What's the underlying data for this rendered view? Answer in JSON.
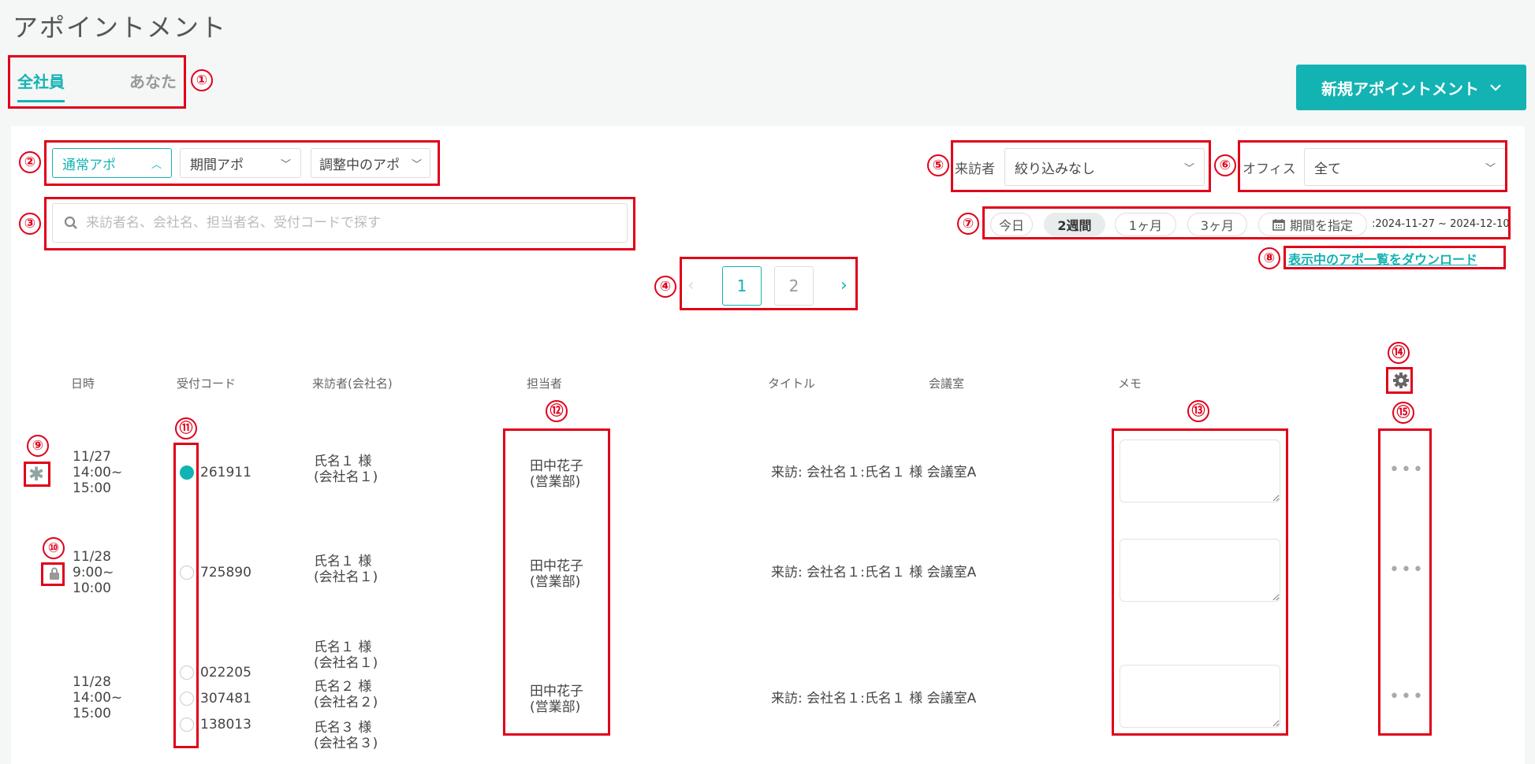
{
  "page": {
    "title": "アポイントメント"
  },
  "tabs": {
    "all": "全社員",
    "you": "あなた"
  },
  "new_button": {
    "label": "新規アポイントメント"
  },
  "filters": {
    "type_dropdowns": [
      "通常アポ",
      "期間アポ",
      "調整中のアポ"
    ],
    "visitor_label": "来訪者",
    "visitor_value": "絞り込みなし",
    "office_label": "オフィス",
    "office_value": "全て"
  },
  "search": {
    "placeholder": "来訪者名、会社名、担当者名、受付コードで探す"
  },
  "period": {
    "buttons": [
      "今日",
      "2週間",
      "1ヶ月",
      "3ヶ月"
    ],
    "custom_label": "期間を指定",
    "range": ":2024-11-27 ~ 2024-12-10"
  },
  "download": {
    "label": "表示中のアポ一覧をダウンロード"
  },
  "pagination": {
    "prev": "‹",
    "pages": [
      "1",
      "2"
    ],
    "next": "›",
    "current": "1"
  },
  "table": {
    "headers": [
      "日時",
      "受付コード",
      "来訪者(会社名)",
      "担当者",
      "タイトル",
      "会議室",
      "メモ"
    ],
    "rows": [
      {
        "date": "11/27",
        "time_start": "14:00~",
        "time_end": "15:00",
        "code": "261911",
        "visitor_name": "氏名１ 様",
        "visitor_company": "(会社名１)",
        "staff_name": "田中花子",
        "staff_dept": "(営業部)",
        "title": "来訪: 会社名１:氏名１ 様",
        "room": "会議室A"
      },
      {
        "date": "11/28",
        "time_start": "9:00~",
        "time_end": "10:00",
        "code": "725890",
        "visitor_name": "氏名１ 様",
        "visitor_company": "(会社名１)",
        "staff_name": "田中花子",
        "staff_dept": "(営業部)",
        "title": "来訪: 会社名１:氏名１ 様",
        "room": "会議室A"
      },
      {
        "date": "11/28",
        "time_start": "14:00~",
        "time_end": "15:00",
        "codes": [
          "022205",
          "307481",
          "138013"
        ],
        "visitors": [
          {
            "name": "氏名１ 様",
            "company": "(会社名１)"
          },
          {
            "name": "氏名２ 様",
            "company": "(会社名２)"
          },
          {
            "name": "氏名３ 様",
            "company": "(会社名３)"
          }
        ],
        "staff_name": "田中花子",
        "staff_dept": "(営業部)",
        "title": "来訪: 会社名１:氏名１ 様",
        "room": "会議室A"
      }
    ]
  },
  "row_menu": {
    "label": "•••"
  },
  "annotations": [
    "①",
    "②",
    "③",
    "④",
    "⑤",
    "⑥",
    "⑦",
    "⑧",
    "⑨",
    "⑩",
    "⑪",
    "⑫",
    "⑬",
    "⑭",
    "⑮"
  ],
  "colors": {
    "accent": "#13b3b3",
    "annotation": "#e0001a"
  }
}
